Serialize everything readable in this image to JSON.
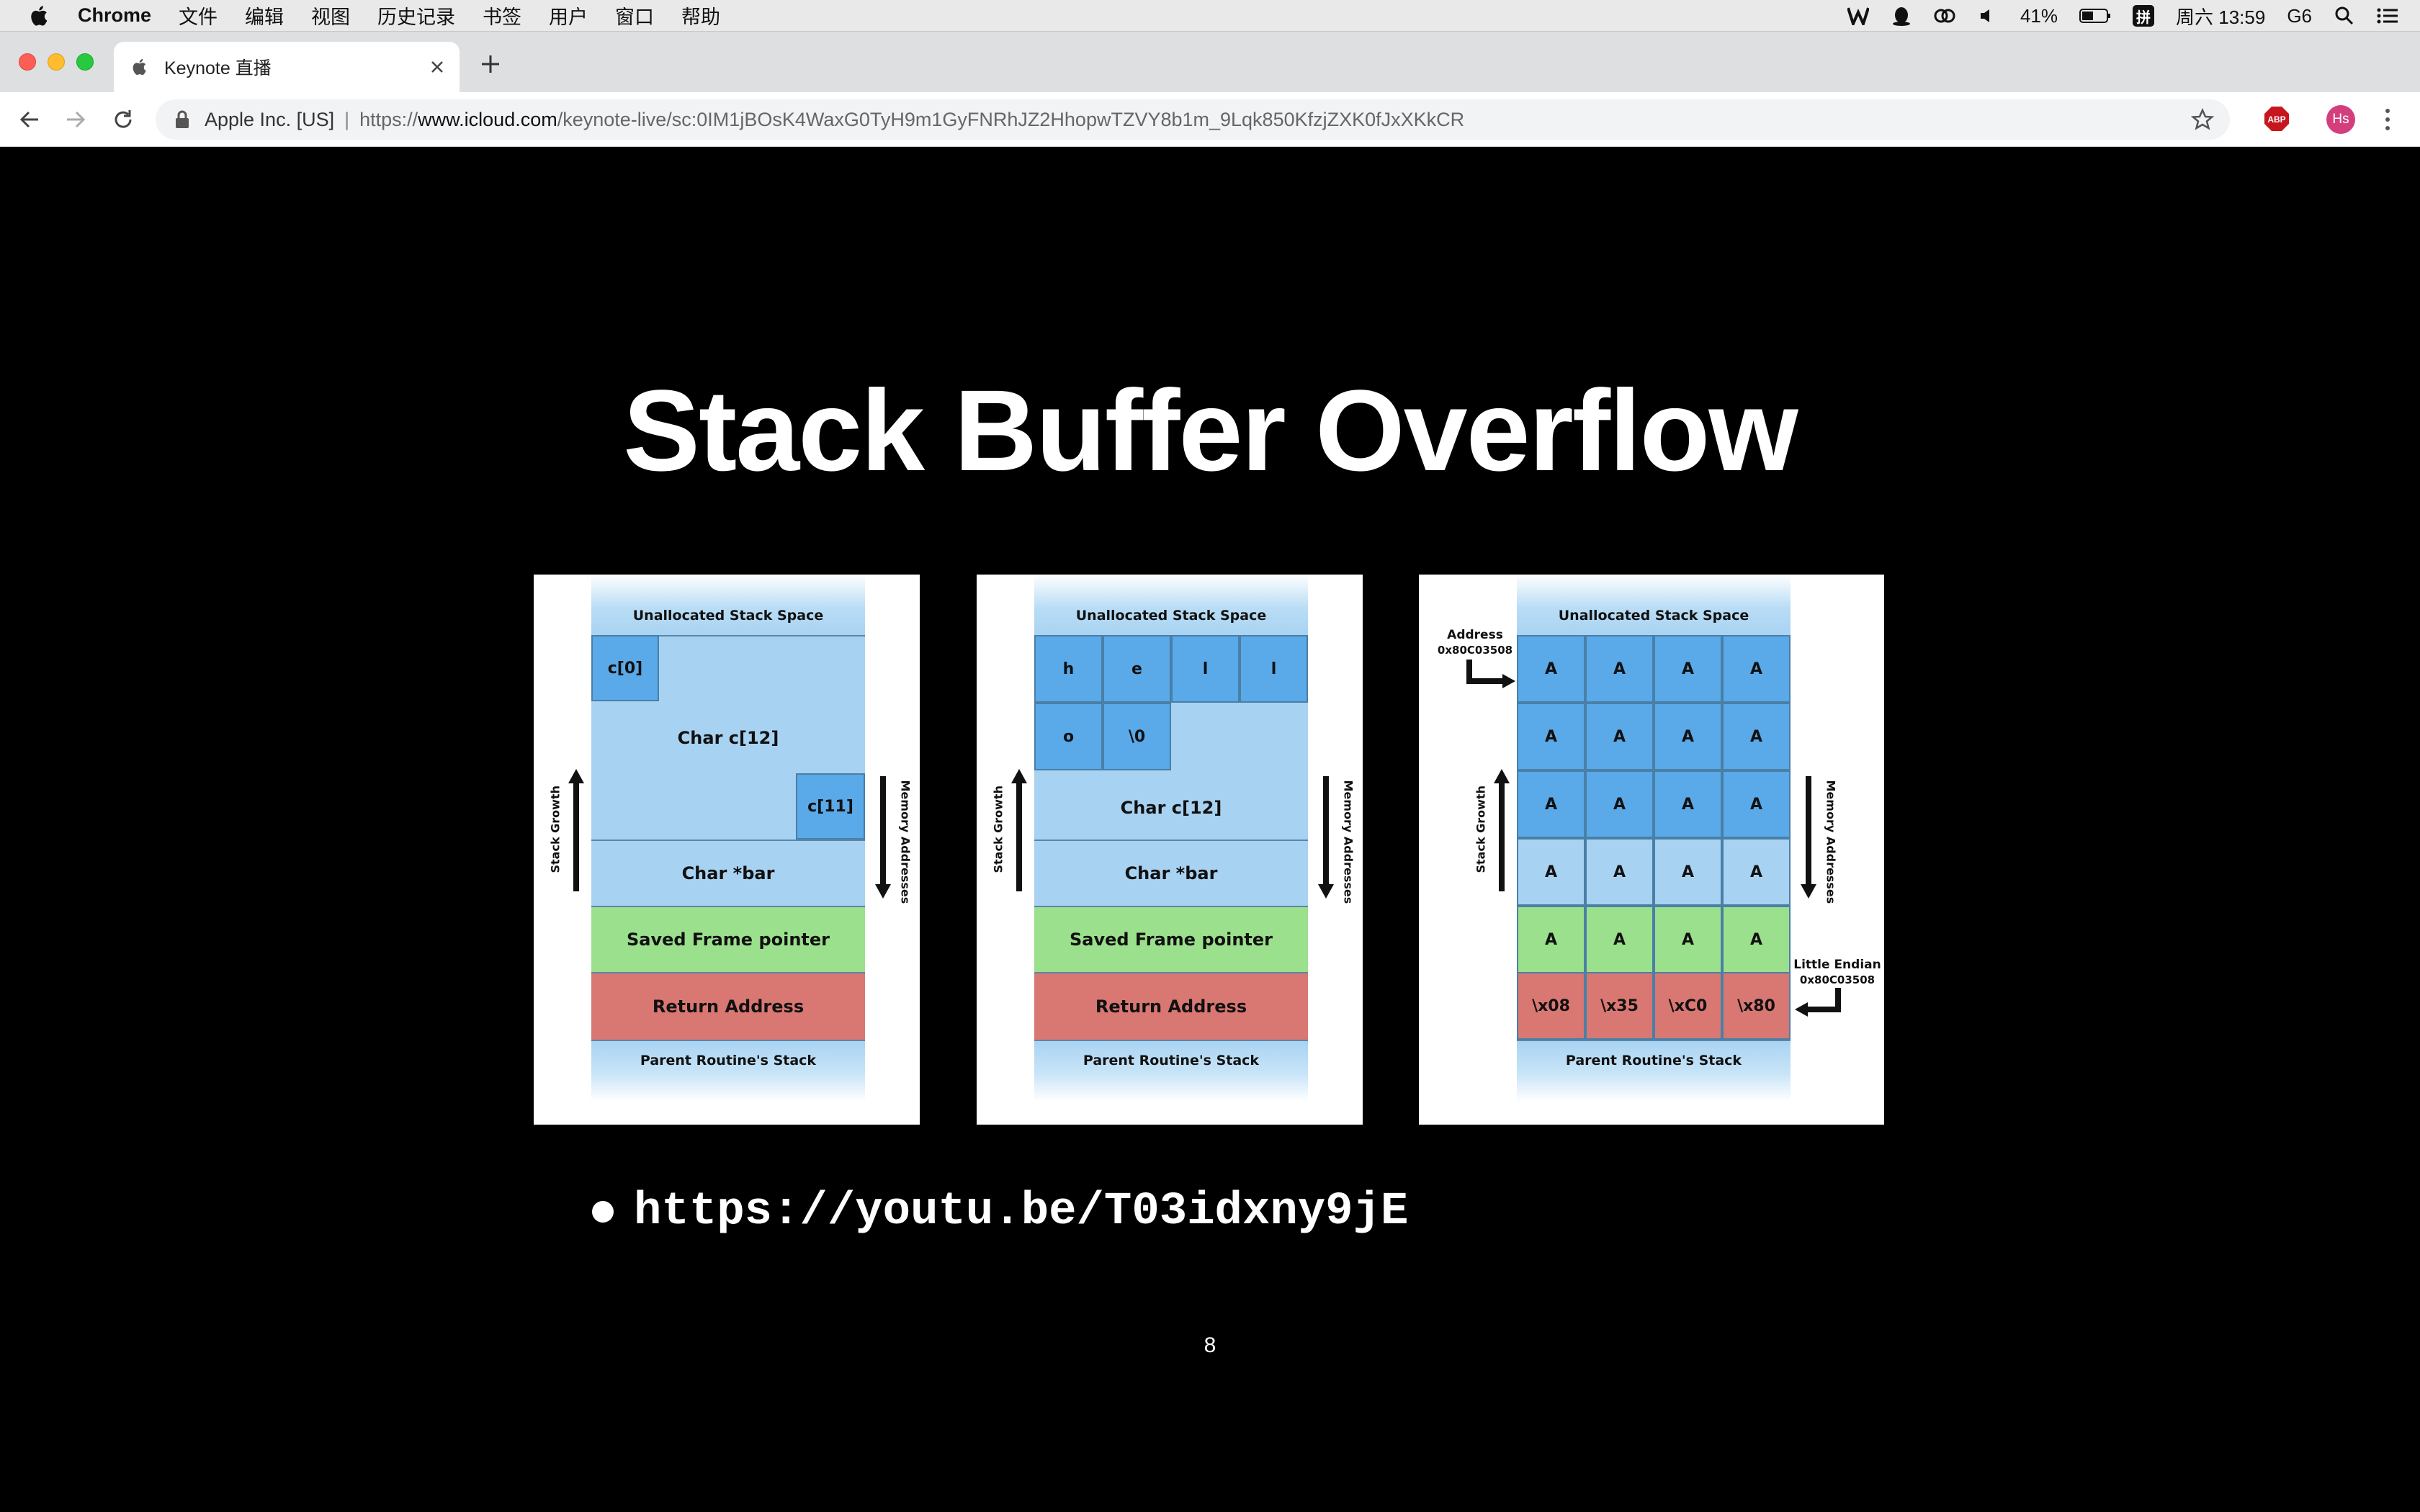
{
  "menubar": {
    "app_name": "Chrome",
    "items": [
      "文件",
      "编辑",
      "视图",
      "历史记录",
      "书签",
      "用户",
      "窗口",
      "帮助"
    ],
    "battery": "41%",
    "input_method": "拼",
    "datetime": "周六 13:59",
    "network": "G6"
  },
  "tab": {
    "title": "Keynote 直播"
  },
  "toolbar": {
    "cert_label": "Apple Inc. [US]",
    "url_prefix": "https://",
    "url_host": "www.icloud.com",
    "url_path": "/keynote-live/sc:0IM1jBOsK4WaxG0TyH9m1GyFNRhJZ2HhopwTZVY8b1m_9Lqk850KfzjZXK0fJxXKkCR",
    "abp_label": "ABP",
    "profile_initials": "Hs"
  },
  "slide": {
    "title": "Stack Buffer Overflow",
    "bullet_link": "https://youtu.be/T03idxny9jE",
    "slide_number": "8"
  },
  "diagrams": {
    "unallocated": "Unallocated Stack Space",
    "parent_stack": "Parent Routine's Stack",
    "stack_growth": "Stack Growth",
    "memory_addresses": "Memory Addresses",
    "char_c12": "Char c[12]",
    "char_bar": "Char *bar",
    "saved_fp": "Saved Frame pointer",
    "return_address": "Return Address",
    "c0": "c[0]",
    "c11": "c[11]",
    "hello_cells": [
      "h",
      "e",
      "l",
      "l",
      "o",
      "\\0"
    ],
    "overflow_cell": "A",
    "address_label": "Address",
    "address_value": "0x80C03508",
    "little_endian": "Little Endian",
    "le_value": "0x80C03508",
    "ret_bytes": [
      "\\x08",
      "\\x35",
      "\\xC0",
      "\\x80"
    ]
  }
}
